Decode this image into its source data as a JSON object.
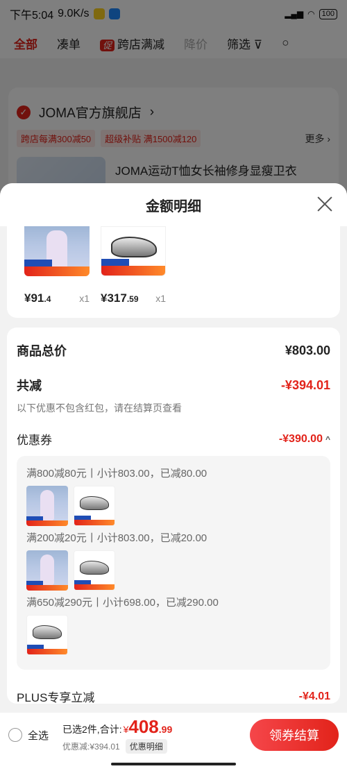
{
  "status_bar": {
    "time": "下午5:04",
    "speed": "9.0K/s",
    "battery": "100"
  },
  "filter_tabs": {
    "all": "全部",
    "bundle": "凑单",
    "promo_tag": "促",
    "cross_store": "跨店满减",
    "price_drop": "降价",
    "filter": "筛选"
  },
  "shop": {
    "name": "JOMA官方旗舰店",
    "promos": [
      "跨店每满300减50",
      "超级补贴 满1500减120"
    ],
    "more": "更多",
    "product_title": "JOMA运动T恤女长袖修身显瘦卫衣"
  },
  "sheet": {
    "title": "金额明细",
    "items": [
      {
        "price_int": "¥91",
        "price_dec": ".4",
        "qty": "x1",
        "image": "hoodie"
      },
      {
        "price_int": "¥317",
        "price_dec": ".59",
        "qty": "x1",
        "image": "shoe"
      }
    ],
    "total_label": "商品总价",
    "total_value": "¥803.00",
    "discount_label": "共减",
    "discount_value": "-¥394.01",
    "discount_note": "以下优惠不包含红包，请在结算页查看",
    "coupon_label": "优惠券",
    "coupon_value": "-¥390.00",
    "coupons": [
      {
        "text": "满800减80元丨小计803.00，已减80.00"
      },
      {
        "text": "满200减20元丨小计803.00，已减20.00"
      },
      {
        "text": "满650减290元丨小计698.00，已减290.00"
      }
    ],
    "plus_label": "PLUS专享立减",
    "plus_value": "-¥4.01"
  },
  "bottom_bar": {
    "select_all": "全选",
    "selected_prefix": "已选2件,合计:",
    "currency": "¥",
    "total_int": "408",
    "total_dec": ".99",
    "saved": "优惠减:¥394.01",
    "detail_chip": "优惠明细",
    "checkout": "领券结算"
  },
  "colors": {
    "accent": "#e2231a",
    "sheet_bg": "#f2f2f2"
  }
}
